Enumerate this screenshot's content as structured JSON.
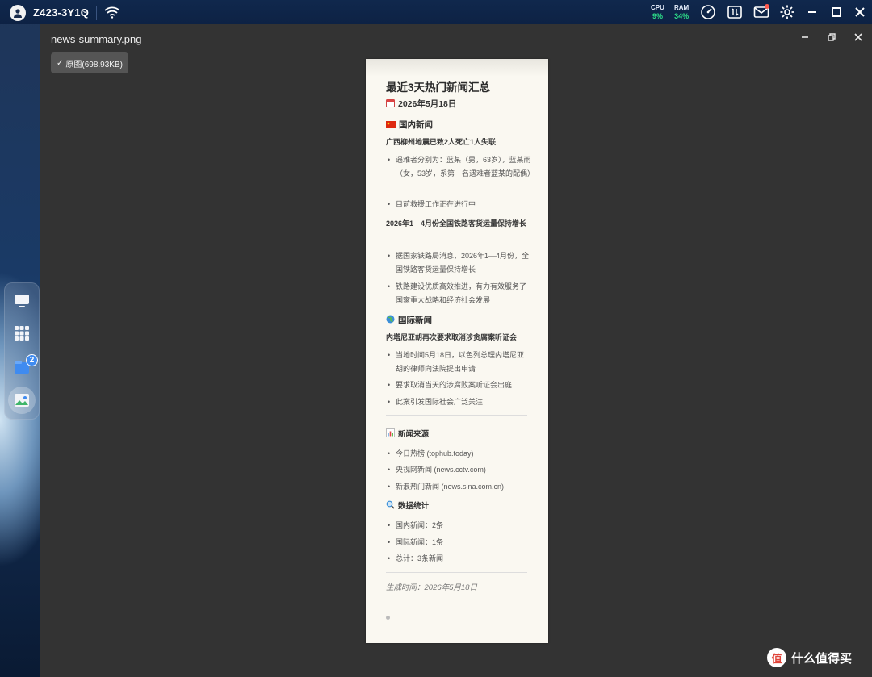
{
  "topbar": {
    "device_name": "Z423-3Y1Q",
    "cpu_label": "CPU",
    "cpu_value": "9%",
    "ram_label": "RAM",
    "ram_value": "34%",
    "accent_green": "#2ee08a",
    "icons": [
      "avatar-icon",
      "wifi-icon",
      "speedometer-icon",
      "transfer-icon",
      "mail-icon",
      "gear-icon",
      "minimize-icon",
      "maximize-icon",
      "close-icon"
    ]
  },
  "dock": {
    "items": [
      {
        "name": "monitor-icon"
      },
      {
        "name": "apps-grid-icon"
      },
      {
        "name": "file-manager-icon",
        "badge": "2"
      },
      {
        "name": "photos-icon",
        "active": true
      }
    ]
  },
  "viewer": {
    "file_name": "news-summary.png",
    "original_button": "原图(698.93KB)",
    "controls": [
      "minimize",
      "restore",
      "close"
    ]
  },
  "document": {
    "title": "最近3天热门新闻汇总",
    "date": "2026年5月18日",
    "domestic": {
      "heading": "国内新闻",
      "story1": {
        "title": "广西柳州地震已致2人死亡1人失联",
        "items": [
          "遇难者分别为：蓝某（男，63岁），蓝某雨（女，53岁，系第一名遇难者蓝某的配偶）",
          "目前救援工作正在进行中"
        ]
      },
      "story2": {
        "title": "2026年1—4月份全国铁路客货运量保持增长",
        "items": [
          "据国家铁路局消息，2026年1—4月份，全国铁路客货运量保持增长",
          "铁路建设优质高效推进，有力有效服务了国家重大战略和经济社会发展"
        ]
      }
    },
    "international": {
      "heading": "国际新闻",
      "story1": {
        "title": "内塔尼亚胡再次要求取消涉贪腐案听证会",
        "items": [
          "当地时间5月18日，以色列总理内塔尼亚胡的律师向法院提出申请",
          "要求取消当天的涉腐败案听证会出庭",
          "此案引发国际社会广泛关注"
        ]
      }
    },
    "sources": {
      "heading": "新闻来源",
      "items": [
        "今日热榜 (tophub.today)",
        "央视网新闻 (news.cctv.com)",
        "新浪热门新闻 (news.sina.com.cn)"
      ]
    },
    "stats": {
      "heading": "数据统计",
      "items": [
        "国内新闻：2条",
        "国际新闻：1条",
        "总计：3条新闻"
      ]
    },
    "generated": "生成时间：2026年5月18日"
  },
  "watermark": {
    "text": "什么值得买",
    "logo_text": "值"
  }
}
